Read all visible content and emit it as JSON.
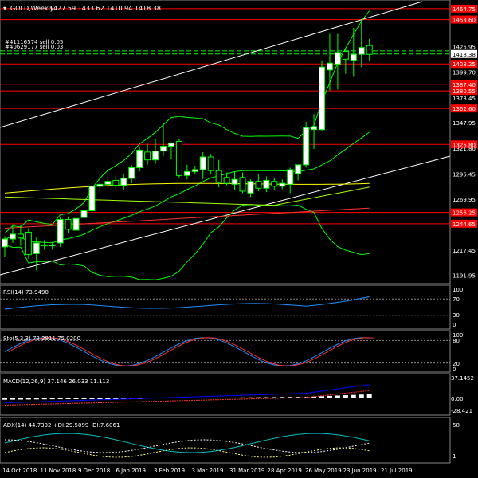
{
  "header": {
    "symbol": "GOLD,Weekly",
    "ohlc": "1427.59 1433.62 1410.94 1418.38",
    "order1": "#41116574 sell 0.05",
    "order2": "#40629177 sell 0.03"
  },
  "colors": {
    "bull": "#ffffff",
    "bear": "#000000",
    "wick": "#00ff00",
    "trendline": "#ffffff",
    "hline": "#ff0000",
    "bb": "#00ff00",
    "ma_yellow": "#ffff00",
    "ma_red": "#ff3030",
    "ma_lime": "#a0ff00",
    "rsi": "#1e90ff",
    "sto_main": "#1e90ff",
    "sto_signal": "#ff3030",
    "macd_signal": "#ff3030",
    "macd_line": "#0000ff",
    "adx": "#00c0c0",
    "pdi": "#ffffff",
    "mdi": "#ffff80"
  },
  "price_axis": {
    "labels": [
      "1464.75",
      "1453.60",
      "1425.95",
      "1418.38",
      "1408.25",
      "1399.70",
      "1387.40",
      "1380.55",
      "1373.45",
      "1362.60",
      "1347.95",
      "1325.80",
      "1321.80",
      "1295.45",
      "1269.95",
      "1256.25",
      "1244.65",
      "1217.45",
      "1191.95"
    ],
    "current": "1418.38"
  },
  "date_axis": [
    "14 Oct 2018",
    "11 Nov 2018",
    "9 Dec 2018",
    "6 Jan 2019",
    "3 Feb 2019",
    "3 Mar 2019",
    "31 Mar 2019",
    "28 Apr 2019",
    "26 May 2019",
    "23 Jun 2019",
    "21 Jul 2019"
  ],
  "chart_data": [
    {
      "type": "candlestick",
      "title": "GOLD,Weekly",
      "ylim": [
        1185,
        1472
      ],
      "candles": [
        {
          "o": 1221,
          "h": 1232,
          "l": 1211,
          "c": 1229
        },
        {
          "o": 1229,
          "h": 1244,
          "l": 1225,
          "c": 1234
        },
        {
          "o": 1234,
          "h": 1243,
          "l": 1222,
          "c": 1230
        },
        {
          "o": 1236,
          "h": 1240,
          "l": 1209,
          "c": 1213
        },
        {
          "o": 1214,
          "h": 1231,
          "l": 1197,
          "c": 1225
        },
        {
          "o": 1223,
          "h": 1228,
          "l": 1218,
          "c": 1222
        },
        {
          "o": 1222,
          "h": 1226,
          "l": 1218,
          "c": 1223
        },
        {
          "o": 1225,
          "h": 1251,
          "l": 1221,
          "c": 1249
        },
        {
          "o": 1249,
          "h": 1252,
          "l": 1235,
          "c": 1239
        },
        {
          "o": 1238,
          "h": 1254,
          "l": 1236,
          "c": 1250
        },
        {
          "o": 1251,
          "h": 1262,
          "l": 1245,
          "c": 1258
        },
        {
          "o": 1258,
          "h": 1286,
          "l": 1252,
          "c": 1283
        },
        {
          "o": 1283,
          "h": 1295,
          "l": 1275,
          "c": 1285
        },
        {
          "o": 1285,
          "h": 1294,
          "l": 1281,
          "c": 1288
        },
        {
          "o": 1289,
          "h": 1294,
          "l": 1280,
          "c": 1284
        },
        {
          "o": 1284,
          "h": 1296,
          "l": 1279,
          "c": 1291
        },
        {
          "o": 1291,
          "h": 1305,
          "l": 1286,
          "c": 1302
        },
        {
          "o": 1302,
          "h": 1323,
          "l": 1298,
          "c": 1320
        },
        {
          "o": 1318,
          "h": 1326,
          "l": 1305,
          "c": 1310
        },
        {
          "o": 1310,
          "h": 1331,
          "l": 1306,
          "c": 1319
        },
        {
          "o": 1319,
          "h": 1348,
          "l": 1314,
          "c": 1324
        },
        {
          "o": 1324,
          "h": 1328,
          "l": 1311,
          "c": 1327
        },
        {
          "o": 1329,
          "h": 1331,
          "l": 1292,
          "c": 1294
        },
        {
          "o": 1294,
          "h": 1305,
          "l": 1290,
          "c": 1298
        },
        {
          "o": 1298,
          "h": 1304,
          "l": 1295,
          "c": 1300
        },
        {
          "o": 1300,
          "h": 1318,
          "l": 1290,
          "c": 1313
        },
        {
          "o": 1313,
          "h": 1316,
          "l": 1296,
          "c": 1299
        },
        {
          "o": 1299,
          "h": 1310,
          "l": 1282,
          "c": 1287
        },
        {
          "o": 1292,
          "h": 1297,
          "l": 1284,
          "c": 1286
        },
        {
          "o": 1285,
          "h": 1298,
          "l": 1279,
          "c": 1290
        },
        {
          "o": 1292,
          "h": 1297,
          "l": 1276,
          "c": 1278
        },
        {
          "o": 1276,
          "h": 1290,
          "l": 1272,
          "c": 1288
        },
        {
          "o": 1288,
          "h": 1296,
          "l": 1278,
          "c": 1281
        },
        {
          "o": 1281,
          "h": 1293,
          "l": 1277,
          "c": 1289
        },
        {
          "o": 1288,
          "h": 1292,
          "l": 1279,
          "c": 1283
        },
        {
          "o": 1283,
          "h": 1290,
          "l": 1280,
          "c": 1286
        },
        {
          "o": 1285,
          "h": 1302,
          "l": 1276,
          "c": 1300
        },
        {
          "o": 1296,
          "h": 1304,
          "l": 1289,
          "c": 1305
        },
        {
          "o": 1305,
          "h": 1349,
          "l": 1302,
          "c": 1343
        },
        {
          "o": 1341,
          "h": 1357,
          "l": 1321,
          "c": 1344
        },
        {
          "o": 1341,
          "h": 1412,
          "l": 1340,
          "c": 1405
        },
        {
          "o": 1402,
          "h": 1439,
          "l": 1381,
          "c": 1409
        },
        {
          "o": 1408,
          "h": 1439,
          "l": 1382,
          "c": 1420
        },
        {
          "o": 1421,
          "h": 1425,
          "l": 1398,
          "c": 1413
        },
        {
          "o": 1412,
          "h": 1445,
          "l": 1395,
          "c": 1418
        },
        {
          "o": 1418,
          "h": 1453,
          "l": 1405,
          "c": 1425
        },
        {
          "o": 1427,
          "h": 1434,
          "l": 1411,
          "c": 1418
        }
      ],
      "hlines": [
        1464.75,
        1453.6,
        1408.25,
        1387.4,
        1380.55,
        1362.6,
        1325.8,
        1256.25,
        1244.65
      ]
    }
  ],
  "rsi": {
    "label": "RSI(14) 73.9490",
    "levels": [
      "100",
      "70",
      "30",
      "0"
    ]
  },
  "sto": {
    "label": "Sto(5,3,3) 72.2911 75.0200",
    "levels": [
      "100",
      "80",
      "20",
      "0"
    ]
  },
  "macd": {
    "label": "MACD(12,26,9) 37.146 26.033 11.113",
    "levels": [
      "37.1452",
      "0.00",
      "-28.421"
    ]
  },
  "adx": {
    "label": "ADX(14) 44.7392 +DI:29.5099 -DI:7.6061",
    "levels": [
      "58",
      "1"
    ]
  }
}
